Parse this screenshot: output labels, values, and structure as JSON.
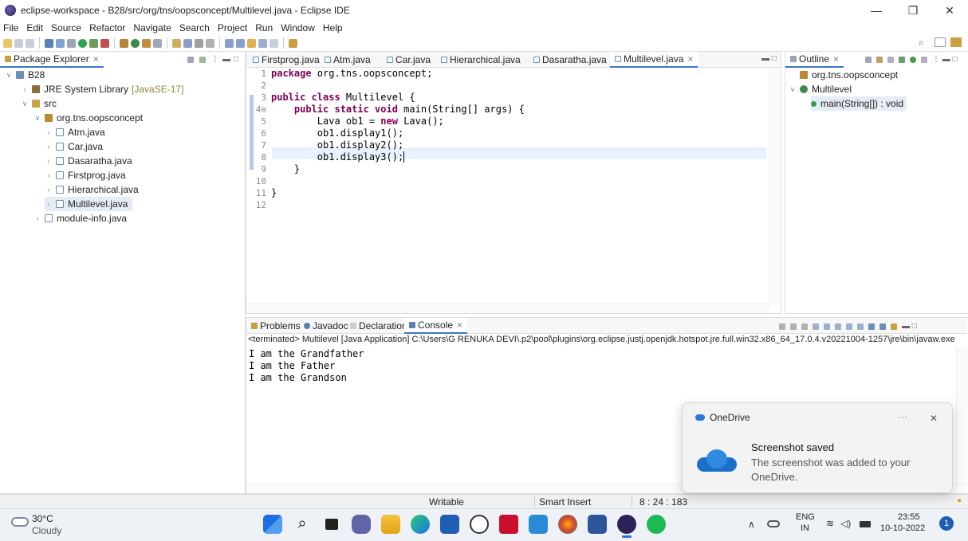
{
  "window": {
    "title": "eclipse-workspace - B28/src/org/tns/oopsconcept/Multilevel.java - Eclipse IDE",
    "minimize_glyph": "—",
    "restore_glyph": "❐",
    "close_glyph": "✕"
  },
  "menu": [
    "File",
    "Edit",
    "Source",
    "Refactor",
    "Navigate",
    "Search",
    "Project",
    "Run",
    "Window",
    "Help"
  ],
  "package_explorer": {
    "tab": "Package Explorer",
    "tree": [
      {
        "label": "B28",
        "extra": ""
      },
      {
        "label": "JRE System Library",
        "extra": "[JavaSE-17]"
      },
      {
        "label": "src",
        "extra": ""
      },
      {
        "label": "org.tns.oopsconcept",
        "extra": ""
      },
      {
        "label": "Atm.java",
        "extra": ""
      },
      {
        "label": "Car.java",
        "extra": ""
      },
      {
        "label": "Dasaratha.java",
        "extra": ""
      },
      {
        "label": "Firstprog.java",
        "extra": ""
      },
      {
        "label": "Hierarchical.java",
        "extra": ""
      },
      {
        "label": "Multilevel.java",
        "extra": ""
      },
      {
        "label": "module-info.java",
        "extra": ""
      }
    ]
  },
  "editor": {
    "tabs": [
      "Firstprog.java",
      "Atm.java",
      "Car.java",
      "Hierarchical.java",
      "Dasaratha.java",
      "Multilevel.java"
    ],
    "active_tab": "Multilevel.java",
    "line_numbers": [
      "1",
      "2",
      "3",
      "4⊖",
      "5",
      "6",
      "7",
      "8",
      "9",
      "10",
      "11",
      "12"
    ],
    "lines": [
      {
        "kw": "package",
        "rest": " org.tns.oopsconcept;"
      },
      {
        "kw": "",
        "rest": ""
      },
      {
        "kw": "public class",
        "rest": " Multilevel {"
      },
      {
        "kw": "    public static void",
        "rest": " main(String[] args) {"
      },
      {
        "kw": "",
        "rest": "        Lava ob1 = ",
        "kw2": "new",
        "rest2": " Lava();"
      },
      {
        "kw": "",
        "rest": "        ob1.display1();"
      },
      {
        "kw": "",
        "rest": "        ob1.display2();"
      },
      {
        "kw": "",
        "rest": "        ob1.display3();"
      },
      {
        "kw": "",
        "rest": "    }"
      },
      {
        "kw": "",
        "rest": ""
      },
      {
        "kw": "",
        "rest": "}"
      },
      {
        "kw": "",
        "rest": ""
      }
    ]
  },
  "outline": {
    "tab": "Outline",
    "items": [
      "org.tns.oopsconcept",
      "Multilevel",
      "main(String[]) : void"
    ]
  },
  "console": {
    "tabs": [
      "Problems",
      "Javadoc",
      "Declaration",
      "Console"
    ],
    "terminated": "<terminated> Multilevel [Java Application] C:\\Users\\G RENUKA DEVI\\.p2\\pool\\plugins\\org.eclipse.justj.openjdk.hotspot.jre.full.win32.x86_64_17.0.4.v20221004-1257\\jre\\bin\\javaw.exe",
    "output": [
      "I am the Grandfather",
      "I am the Father",
      "I am the Grandson"
    ]
  },
  "statusbar": {
    "writable": "Writable",
    "insert": "Smart Insert",
    "position": "8 : 24 : 183"
  },
  "toast": {
    "app": "OneDrive",
    "more": "···",
    "close": "✕",
    "heading": "Screenshot saved",
    "body": "The screenshot was added to your OneDrive."
  },
  "taskbar": {
    "weather_temp": "30°C",
    "weather_desc": "Cloudy",
    "lang": "ENG",
    "region": "IN",
    "time": "23:55",
    "date": "10-10-2022",
    "notif_count": "1"
  }
}
